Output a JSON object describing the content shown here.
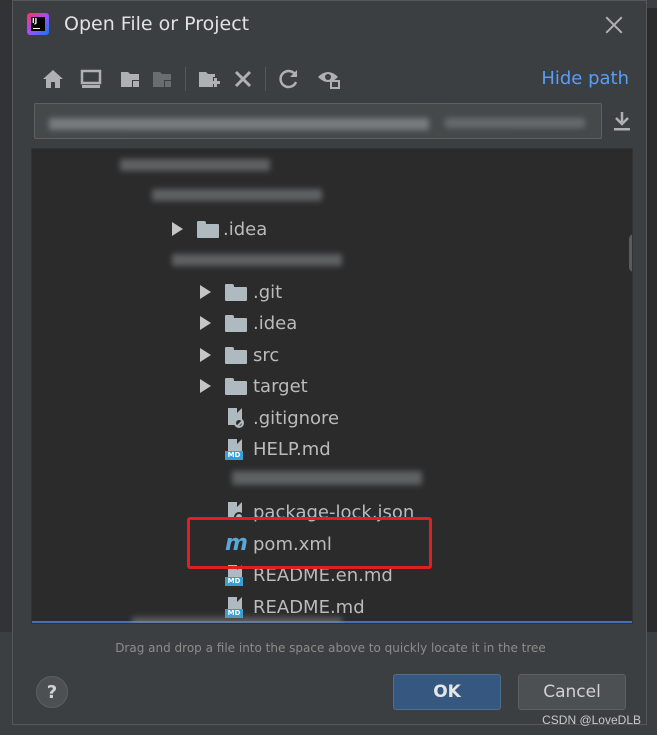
{
  "window": {
    "title": "Open File or Project",
    "app_icon": "intellij-idea-icon",
    "app_icon_text": "IJ"
  },
  "toolbar": {
    "icons": [
      "home-icon",
      "desktop-icon",
      "project-folder-icon",
      "module-folder-icon",
      "new-folder-icon",
      "delete-icon",
      "refresh-icon",
      "show-hidden-icon"
    ],
    "hide_path_label": "Hide path"
  },
  "tree": {
    "items": [
      {
        "label": ".idea",
        "type": "folder",
        "expandable": true
      },
      {
        "label": ".git",
        "type": "folder",
        "expandable": true
      },
      {
        "label": ".idea",
        "type": "folder",
        "expandable": true
      },
      {
        "label": "src",
        "type": "folder",
        "expandable": true
      },
      {
        "label": "target",
        "type": "folder",
        "expandable": true
      },
      {
        "label": ".gitignore",
        "type": "file-ignore"
      },
      {
        "label": "HELP.md",
        "type": "file-md"
      },
      {
        "label": "package-lock.json",
        "type": "file-json"
      },
      {
        "label": "pom.xml",
        "type": "file-maven"
      },
      {
        "label": "README.en.md",
        "type": "file-md"
      },
      {
        "label": "README.md",
        "type": "file-md"
      }
    ]
  },
  "hint": "Drag and drop a file into the space above to quickly locate it in the tree",
  "buttons": {
    "help": "?",
    "ok": "OK",
    "cancel": "Cancel"
  },
  "badges": {
    "md": "MD",
    "maven": "m"
  },
  "watermark": "CSDN @LoveDLB",
  "colors": {
    "accent_link": "#589df6",
    "ok_button": "#365880",
    "selection": "#4b6eaf",
    "highlight_box": "#e02020"
  }
}
